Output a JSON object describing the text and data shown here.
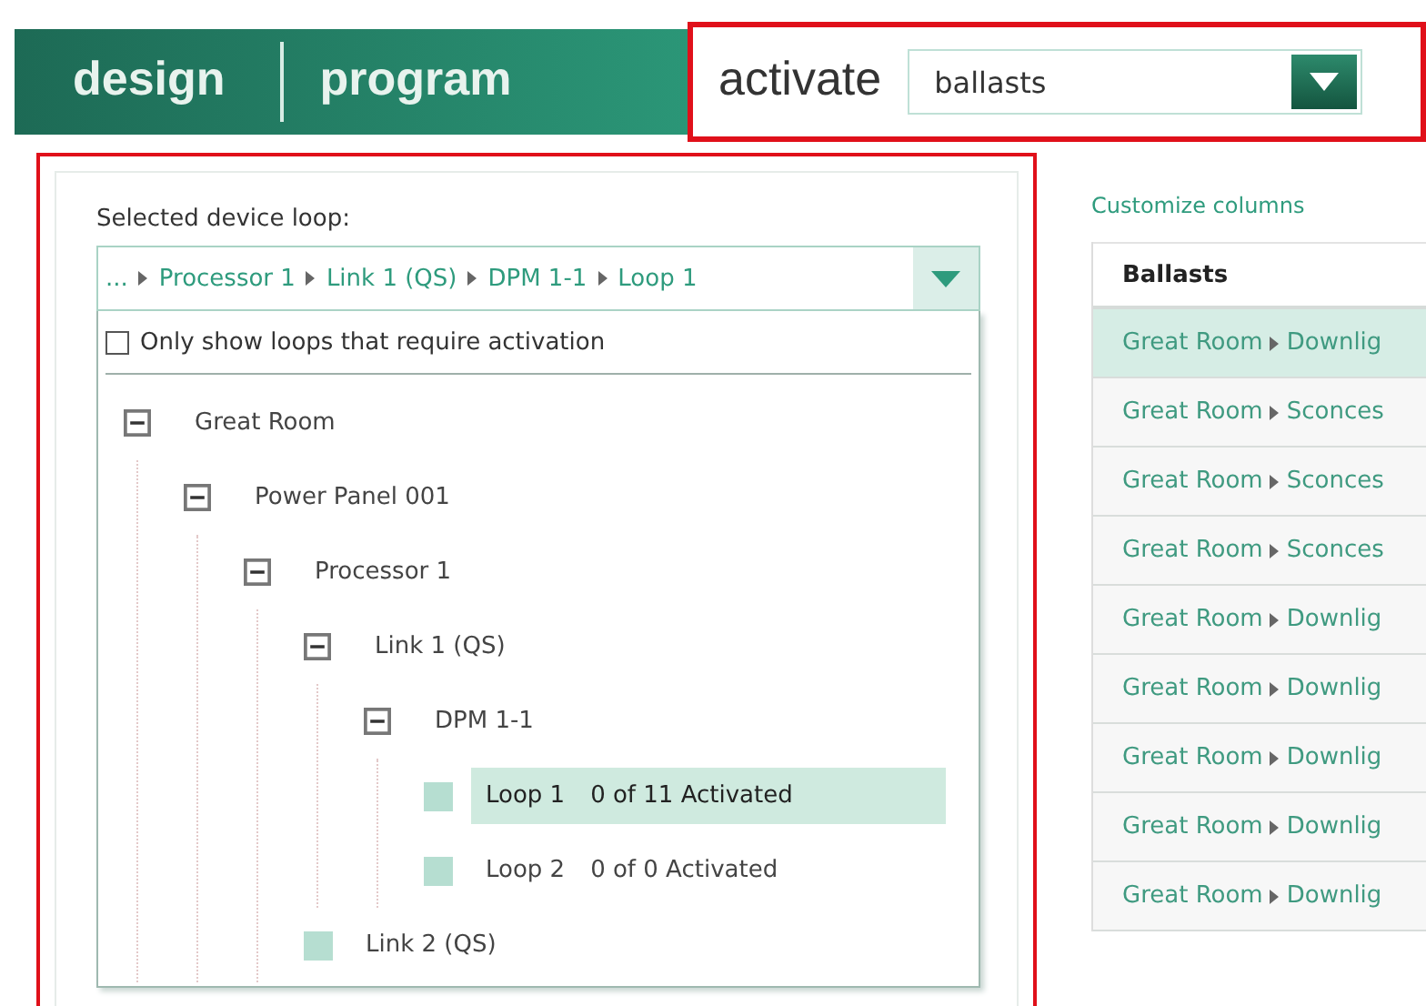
{
  "nav": {
    "tabs": [
      {
        "label": "design",
        "selected": false
      },
      {
        "label": "program",
        "selected": false
      }
    ]
  },
  "activate": {
    "label": "activate",
    "select": {
      "value": "ballasts"
    }
  },
  "loop_picker": {
    "label": "Selected device loop:",
    "breadcrumb": [
      "...",
      "Processor 1",
      "Link 1 (QS)",
      "DPM 1-1",
      "Loop 1"
    ],
    "filter": {
      "label": "Only show loops that require activation",
      "checked": false
    },
    "tree": [
      {
        "label": "Great Room",
        "kind": "group",
        "expanded": true,
        "selected": false,
        "children": [
          {
            "label": "Power Panel 001",
            "kind": "group",
            "expanded": true,
            "selected": false,
            "children": [
              {
                "label": "Processor 1",
                "kind": "group",
                "expanded": true,
                "selected": false,
                "children": [
                  {
                    "label": "Link 1 (QS)",
                    "kind": "group",
                    "expanded": true,
                    "selected": false,
                    "children": [
                      {
                        "label": "DPM 1-1",
                        "kind": "group",
                        "expanded": true,
                        "selected": false,
                        "children": [
                          {
                            "label": "Loop 1",
                            "status": "0 of 11 Activated",
                            "kind": "leaf",
                            "selected": true
                          },
                          {
                            "label": "Loop 2",
                            "status": "0 of 0 Activated",
                            "kind": "leaf",
                            "selected": false
                          }
                        ]
                      }
                    ]
                  },
                  {
                    "label": "Link 2 (QS)",
                    "kind": "leaf",
                    "selected": false
                  }
                ]
              }
            ]
          }
        ]
      }
    ]
  },
  "table": {
    "customize_link": "Customize columns",
    "columns": [
      "Ballasts"
    ],
    "rows": [
      {
        "path": [
          "Great Room",
          "Downlig"
        ],
        "selected": true
      },
      {
        "path": [
          "Great Room",
          "Sconces"
        ],
        "selected": false
      },
      {
        "path": [
          "Great Room",
          "Sconces"
        ],
        "selected": false
      },
      {
        "path": [
          "Great Room",
          "Sconces"
        ],
        "selected": false
      },
      {
        "path": [
          "Great Room",
          "Downlig"
        ],
        "selected": false
      },
      {
        "path": [
          "Great Room",
          "Downlig"
        ],
        "selected": false
      },
      {
        "path": [
          "Great Room",
          "Downlig"
        ],
        "selected": false
      },
      {
        "path": [
          "Great Room",
          "Downlig"
        ],
        "selected": false
      },
      {
        "path": [
          "Great Room",
          "Downlig"
        ],
        "selected": false
      }
    ]
  }
}
